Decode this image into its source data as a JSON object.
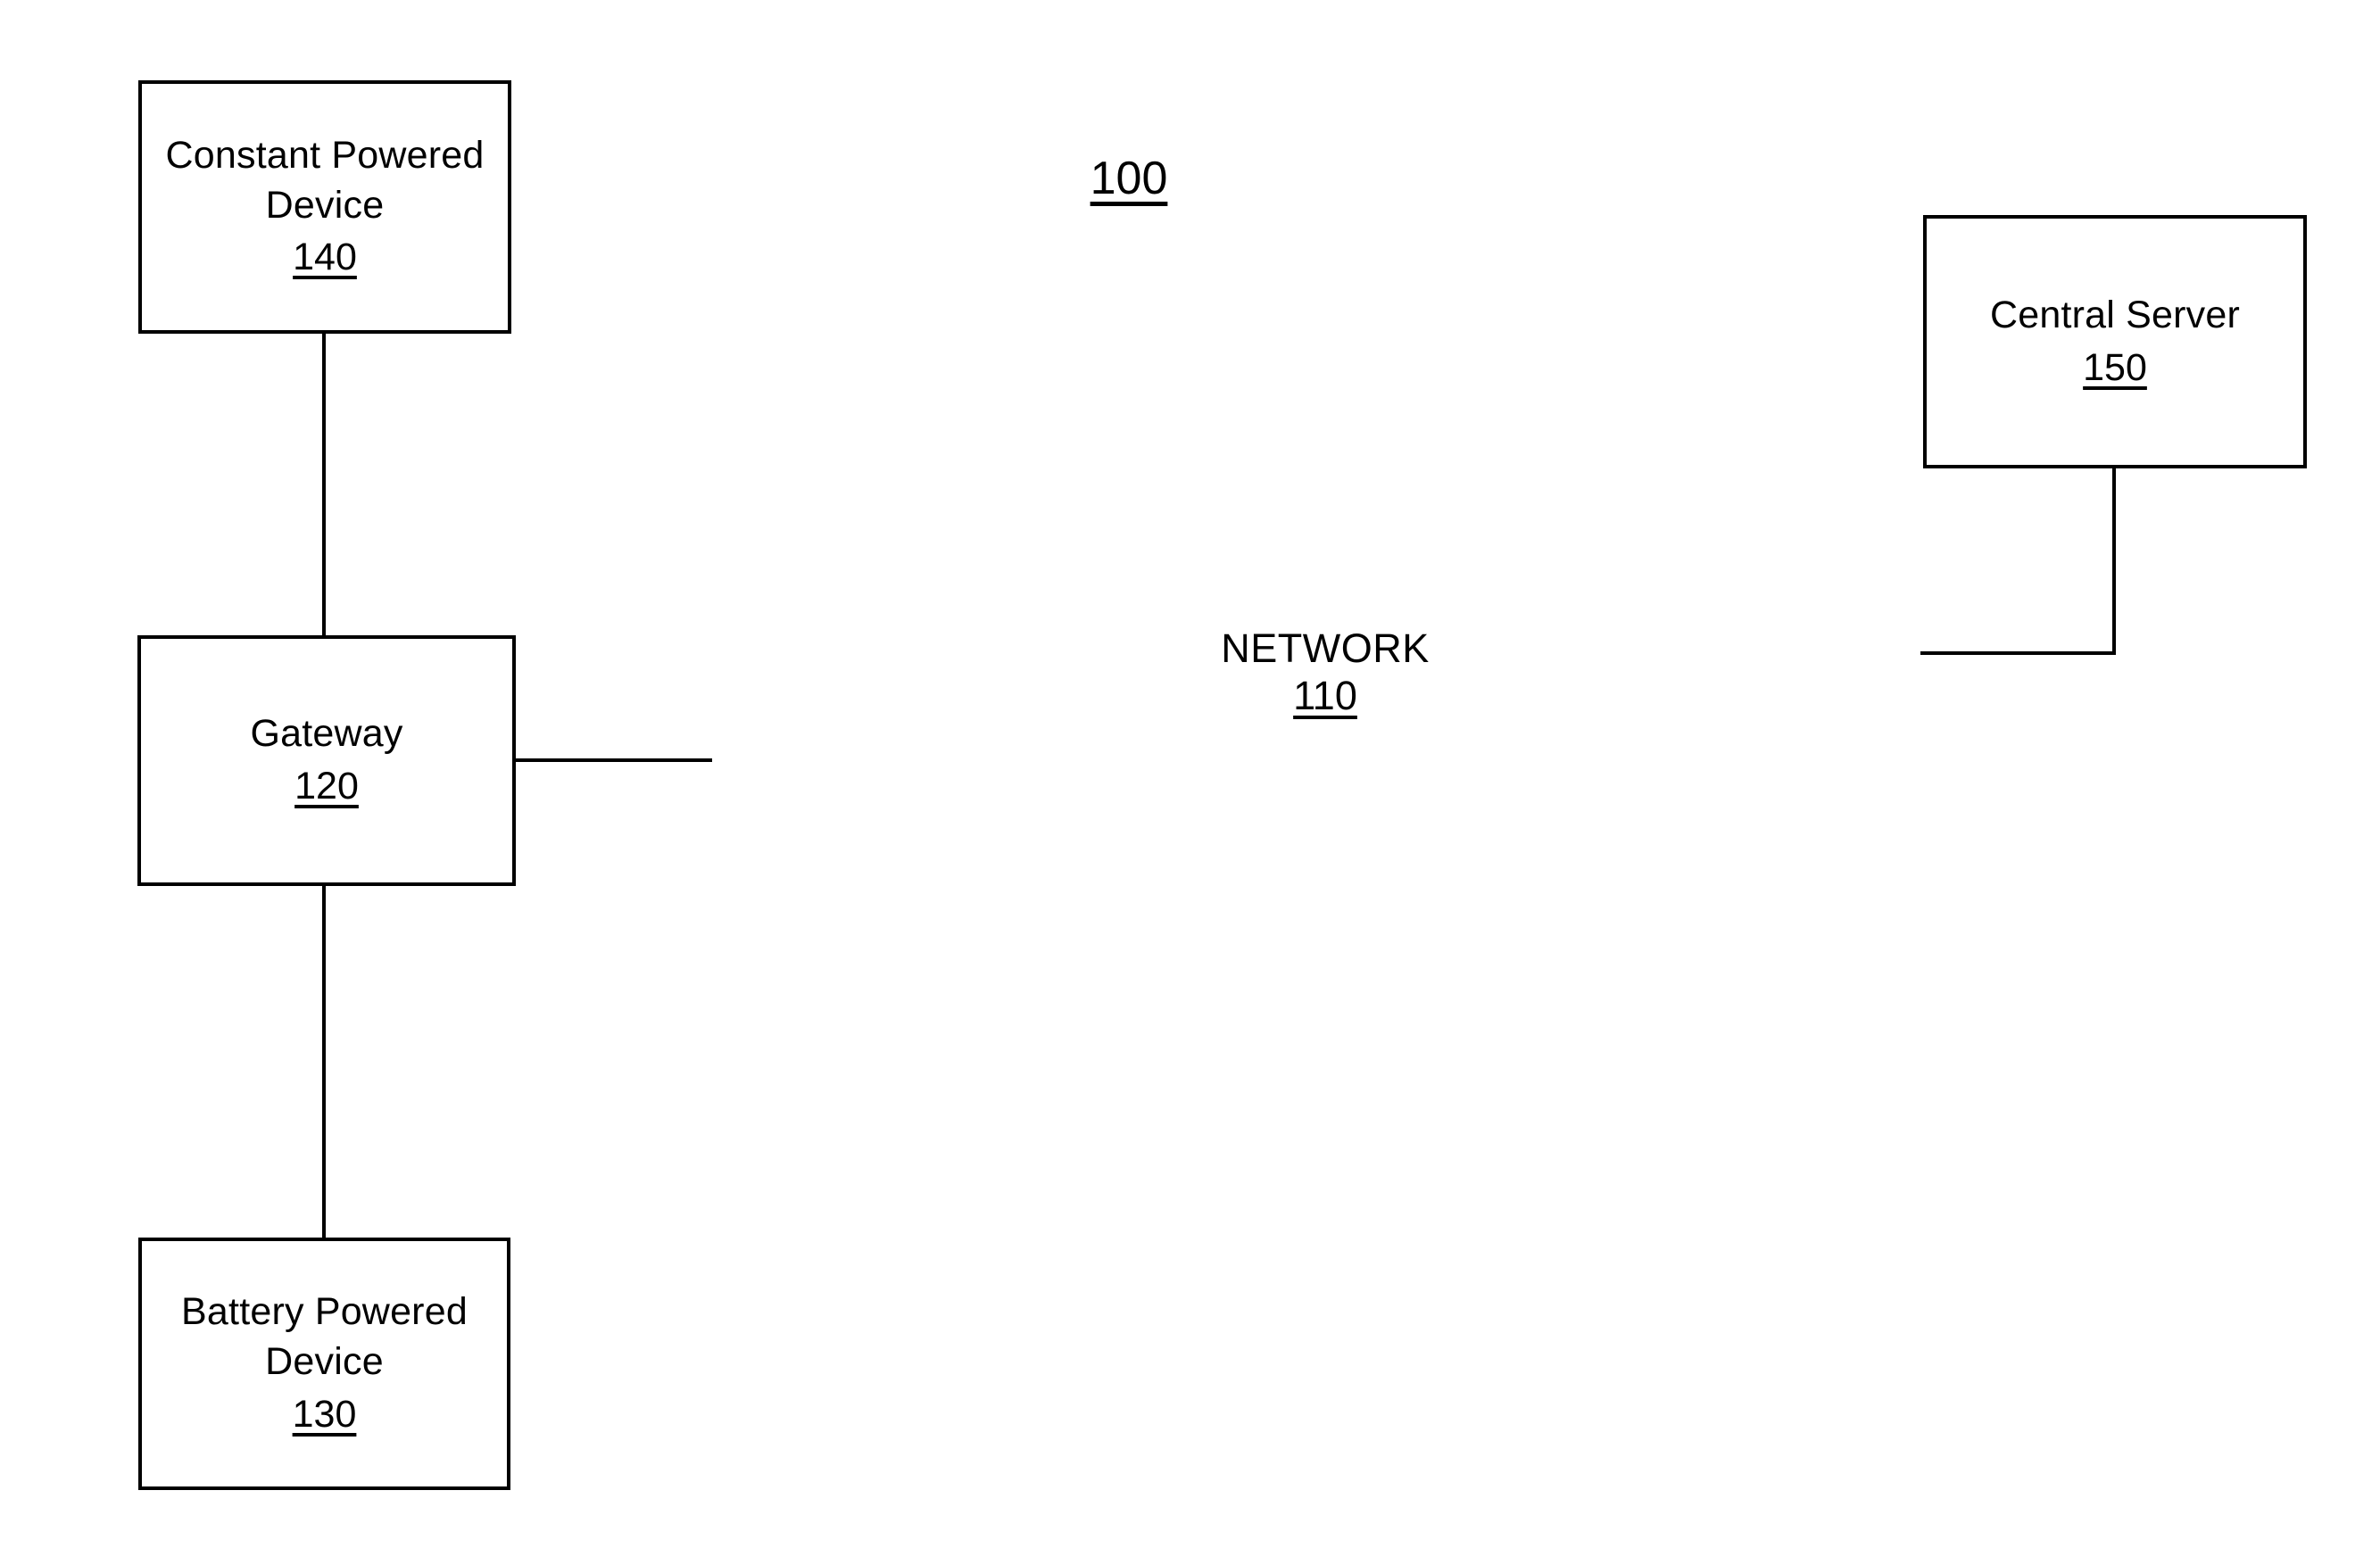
{
  "figure": {
    "reference_numeral": "100",
    "background_color": "#ffffff",
    "line_color": "#000000"
  },
  "nodes": [
    {
      "id": "constant-powered-device",
      "label": "Constant Powered\nDevice",
      "reference_numeral": "140"
    },
    {
      "id": "gateway",
      "label": "Gateway",
      "reference_numeral": "120"
    },
    {
      "id": "battery-powered-device",
      "label": "Battery Powered\nDevice",
      "reference_numeral": "130"
    },
    {
      "id": "central-server",
      "label": "Central Server",
      "reference_numeral": "150"
    }
  ],
  "cloud": {
    "id": "network-cloud",
    "label": "NETWORK",
    "reference_numeral": "110",
    "fill_color": "#808080",
    "texture": "halftone-dither"
  }
}
